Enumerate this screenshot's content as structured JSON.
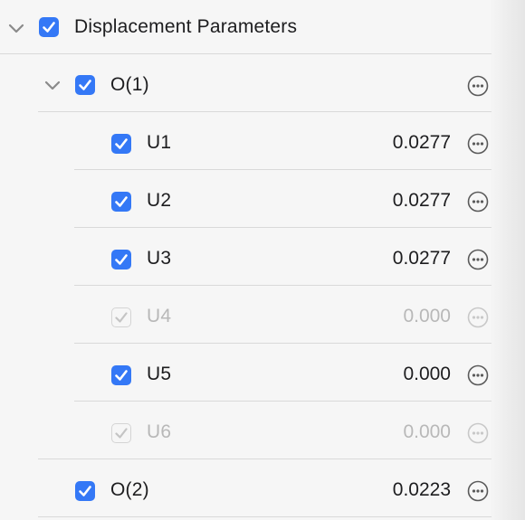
{
  "tree": {
    "group": {
      "label": "Displacement Parameters",
      "checked": true,
      "expanded": true
    },
    "nodes": [
      {
        "label": "O(1)",
        "value": "",
        "checked": true,
        "enabled": true,
        "expanded": true
      },
      {
        "label": "U1",
        "value": "0.0277",
        "checked": true,
        "enabled": true
      },
      {
        "label": "U2",
        "value": "0.0277",
        "checked": true,
        "enabled": true
      },
      {
        "label": "U3",
        "value": "0.0277",
        "checked": true,
        "enabled": true
      },
      {
        "label": "U4",
        "value": "0.000",
        "checked": true,
        "enabled": false
      },
      {
        "label": "U5",
        "value": "0.000",
        "checked": true,
        "enabled": true
      },
      {
        "label": "U6",
        "value": "0.000",
        "checked": true,
        "enabled": false
      },
      {
        "label": "O(2)",
        "value": "0.0223",
        "checked": true,
        "enabled": true
      }
    ]
  },
  "icons": {
    "disclosure": "chevron-down-icon",
    "more": "more-options-icon",
    "checkbox": "checkmark-icon"
  },
  "colors": {
    "accent": "#3478f6",
    "disabled_text": "#b8b8b8",
    "separator": "#d9d9d9"
  }
}
